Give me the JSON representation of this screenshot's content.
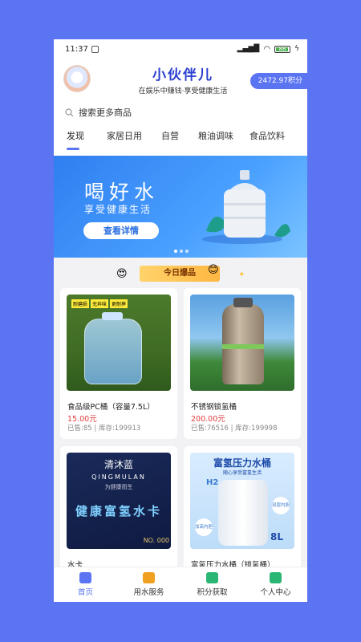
{
  "status": {
    "time": "11:37",
    "battery": "88"
  },
  "header": {
    "title": "小伙伴儿",
    "subtitle": "在娱乐中赚钱·享受健康生活",
    "points": "2472.97积分"
  },
  "search": {
    "placeholder": "搜索更多商品"
  },
  "tabs": [
    "发现",
    "家居日用",
    "自营",
    "粮油调味",
    "食品饮料"
  ],
  "banner": {
    "title": "喝好水",
    "subtitle": "享受健康生活",
    "button": "查看详情"
  },
  "hot": {
    "label": "今日爆品"
  },
  "products": [
    {
      "name": "食品级PC桶（容量7.5L）",
      "price": "15.00元",
      "meta": "已售:85 | 库存:199913",
      "tags": [
        "耐磨损",
        "无异味",
        "更耐摔"
      ]
    },
    {
      "name": "不锈钢锁氢桶",
      "price": "200.00元",
      "meta": "已售:76516 | 库存:199998"
    },
    {
      "name": "水卡",
      "price": "",
      "meta": "",
      "brand": "清沐蓝",
      "brand_en": "QINGMULAN",
      "slogan": "为健康而生",
      "card_text": "健康富氢水卡",
      "card_no": "NO. 000"
    },
    {
      "name": "富氢压力水桶（锁氢桶）",
      "price": "",
      "meta": "",
      "img_title": "富氢压力水桶",
      "img_sub": "随心享受富氢生活",
      "badge1": "双层内胆",
      "badge2": "加高内胆",
      "vol": "8L",
      "h2": "H2"
    }
  ],
  "tabbar": [
    "首页",
    "用水服务",
    "积分获取",
    "个人中心"
  ],
  "colors": {
    "accent": "#5B74F2",
    "price": "#E03A3A"
  }
}
